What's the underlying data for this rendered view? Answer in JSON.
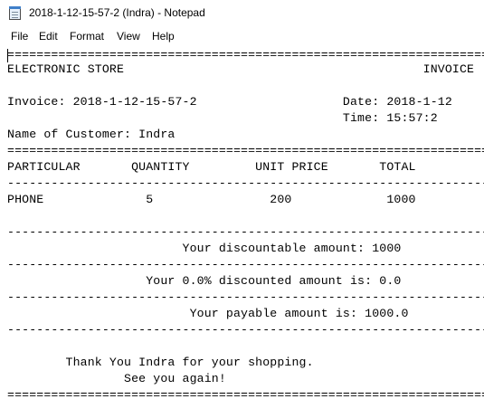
{
  "window": {
    "title": "2018-1-12-15-57-2 (Indra) - Notepad",
    "icon": "notepad-icon"
  },
  "menu": [
    "File",
    "Edit",
    "Format",
    "View",
    "Help"
  ],
  "document": {
    "lines": [
      "==================================================================",
      "ELECTRONIC STORE                                         INVOICE",
      "",
      "Invoice: 2018-1-12-15-57-2                    Date: 2018-1-12",
      "                                              Time: 15:57:2",
      "Name of Customer: Indra",
      "==================================================================",
      "PARTICULAR       QUANTITY         UNIT PRICE       TOTAL",
      "------------------------------------------------------------------",
      "PHONE              5                200             1000",
      "",
      "------------------------------------------------------------------",
      "                        Your discountable amount: 1000",
      "------------------------------------------------------------------",
      "                   Your 0.0% discounted amount is: 0.0",
      "------------------------------------------------------------------",
      "                         Your payable amount is: 1000.0",
      "------------------------------------------------------------------",
      "",
      "        Thank You Indra for your shopping.",
      "                See you again!",
      "=================================================================="
    ]
  }
}
